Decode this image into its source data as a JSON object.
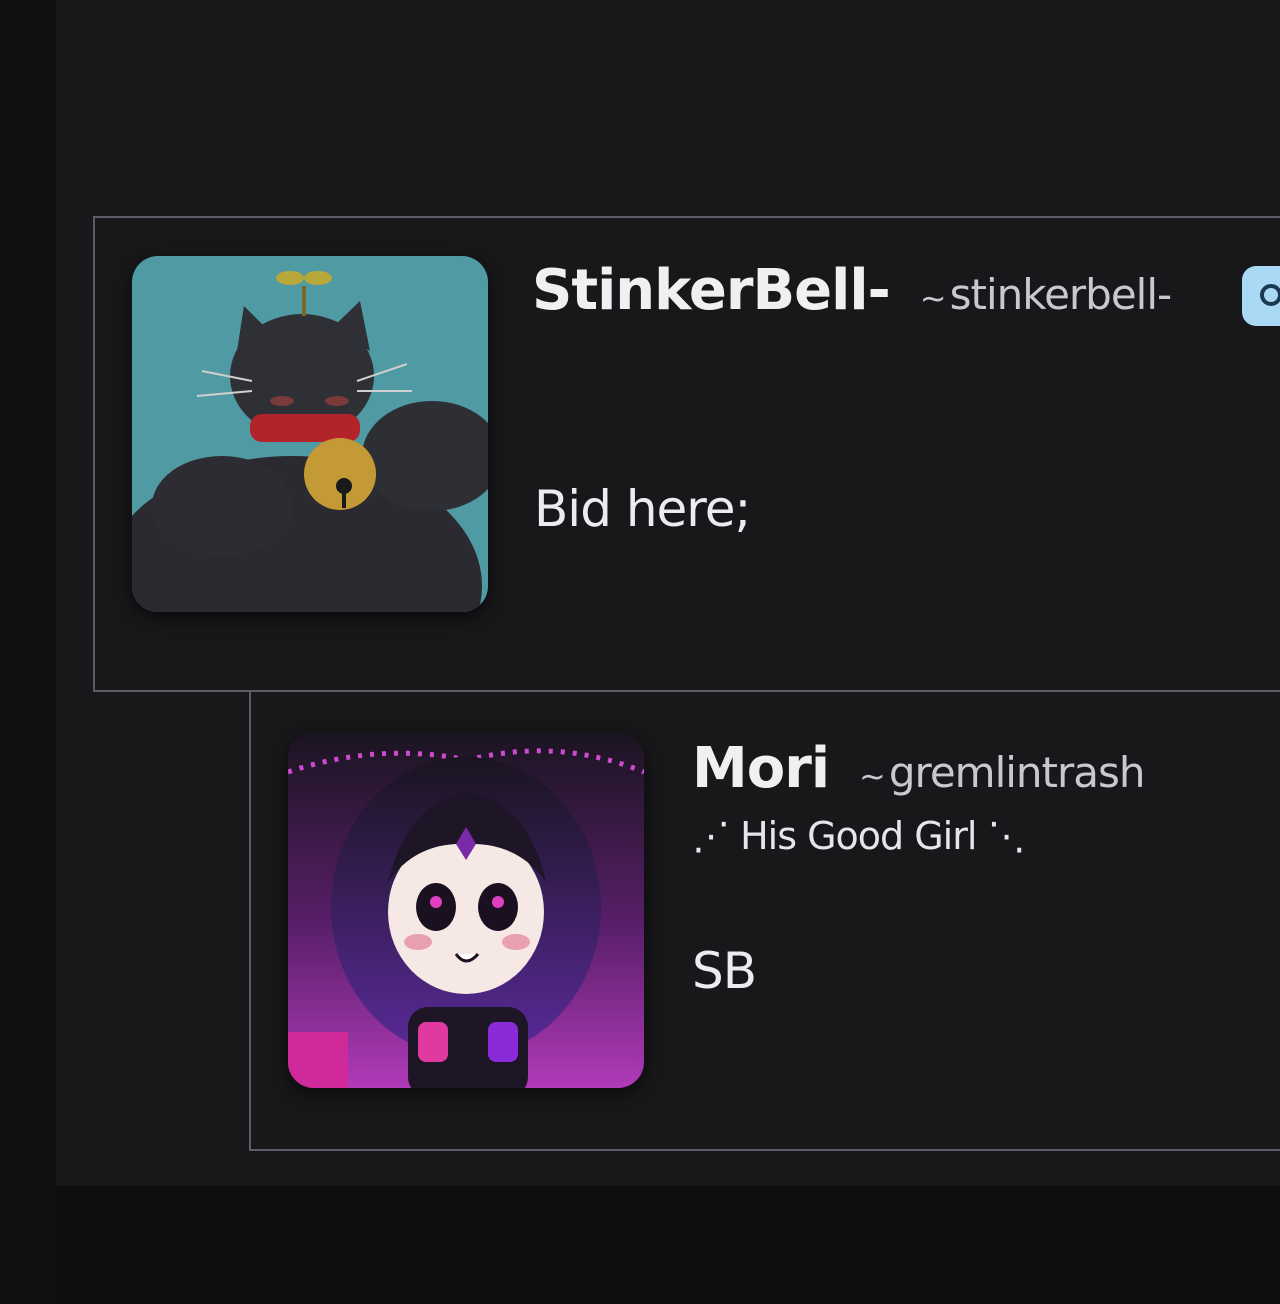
{
  "comments": [
    {
      "display_name": "StinkerBell-",
      "username_prefix": "~",
      "username": "stinkerbell-",
      "body": "Bid here;",
      "avatar_icon": "black-cat-with-bell-avatar",
      "badge_icon": "badge-icon",
      "colors": {
        "avatar_bg": "#4f9aa3",
        "badge_bg": "#a9d9f5"
      }
    },
    {
      "display_name": "Mori",
      "username_prefix": "~",
      "username": "gremlintrash",
      "tagline": "⋰ His Good Girl ⋱",
      "body": "SB",
      "avatar_icon": "chibi-girl-avatar",
      "colors": {
        "avatar_bg": "#6a1f7a"
      }
    }
  ],
  "colors": {
    "page_bg": "#18181b",
    "rail_bg": "#101012",
    "border": "#5c5c68",
    "text": "#ececf0"
  }
}
